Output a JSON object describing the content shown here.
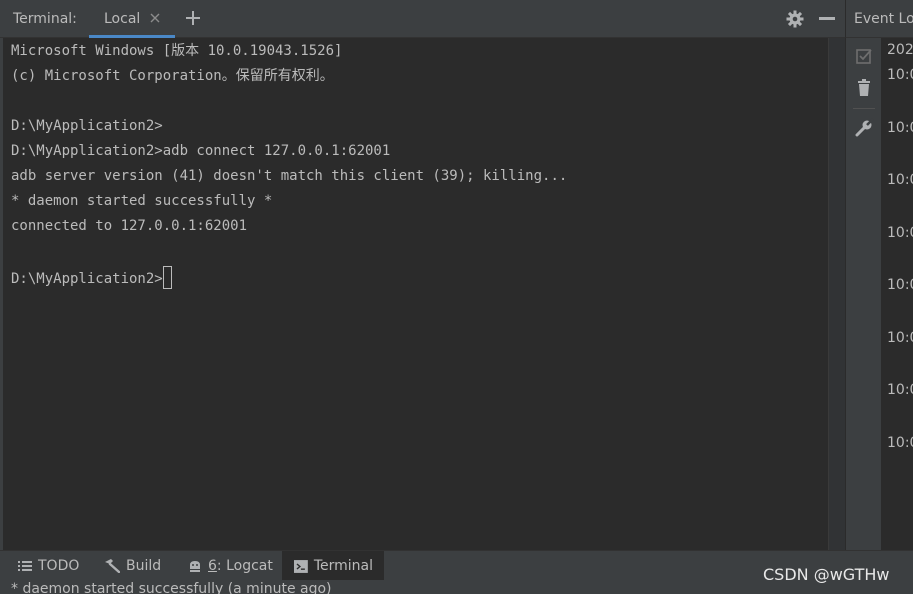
{
  "terminal_header": {
    "title": "Terminal:",
    "tab_label": "Local",
    "close_icon": "close-icon",
    "new_tab_icon": "plus-icon",
    "settings_icon": "gear-icon",
    "minimize_icon": "minimize-icon"
  },
  "terminal": {
    "lines": [
      "Microsoft Windows [版本 10.0.19043.1526]",
      "(c) Microsoft Corporation。保留所有权利。",
      "",
      "D:\\MyApplication2>",
      "D:\\MyApplication2>adb connect 127.0.0.1:62001",
      "adb server version (41) doesn't match this client (39); killing...",
      "* daemon started successfully *",
      "connected to 127.0.0.1:62001",
      "",
      "D:\\MyApplication2>"
    ]
  },
  "event_log": {
    "title": "Event Lo",
    "date_partial": "202",
    "times": [
      "10:0",
      "10:0",
      "10:0",
      "10:0",
      "10:0",
      "10:0",
      "10:0",
      "10:0"
    ],
    "tool_icons": [
      "mark-read-icon",
      "trash-icon",
      "wrench-icon"
    ]
  },
  "toolbar": {
    "todo": "TODO",
    "build": "Build",
    "logcat_num": "6",
    "logcat_rest": ": Logcat",
    "terminal": "Terminal"
  },
  "status": {
    "message": "* daemon started successfully (a minute ago)"
  },
  "watermark": "CSDN @wGTHw",
  "colors": {
    "background": "#2b2b2b",
    "panel": "#3c3f41",
    "text": "#bbbbbb",
    "active_tab_underline": "#4a88c7"
  }
}
